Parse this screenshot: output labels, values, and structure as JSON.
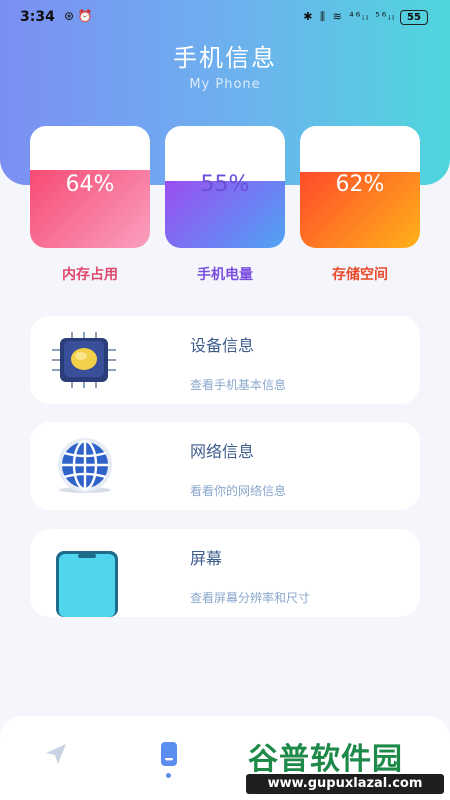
{
  "status_bar": {
    "time": "3:34",
    "left_icons": "⊛ ⏰",
    "right_icons": "✱ ⫼ ≋ ⁴⁶ᵢₗ ⁵⁶ᵢₗ",
    "battery": "55"
  },
  "header": {
    "title": "手机信息",
    "subtitle": "My Phone"
  },
  "stats": [
    {
      "value": "64%",
      "label": "内存占用",
      "fraction": 0.64,
      "gradient": [
        "#f84a73",
        "#f9a0c0"
      ],
      "label_color": "#e3476c"
    },
    {
      "value": "55%",
      "label": "手机电量",
      "fraction": 0.55,
      "gradient": [
        "#9a4ef0",
        "#4fa3f5"
      ],
      "label_color": "#7a4fe0"
    },
    {
      "value": "62%",
      "label": "存储空间",
      "fraction": 0.62,
      "gradient": [
        "#ff4a2a",
        "#ffb21a"
      ],
      "label_color": "#ea4a2c"
    }
  ],
  "info_items": [
    {
      "title": "设备信息",
      "desc": "查看手机基本信息",
      "icon": "chip-icon"
    },
    {
      "title": "网络信息",
      "desc": "看看你的网络信息",
      "icon": "globe-icon"
    },
    {
      "title": "屏幕",
      "desc": "查看屏幕分辨率和尺寸",
      "icon": "phone-screen-icon"
    }
  ],
  "nav": {
    "items": [
      "send-icon",
      "phone-icon"
    ],
    "active": 1
  },
  "watermark": {
    "main": "谷普软件园",
    "url": "www.gupuxlazal.com"
  },
  "colors": {
    "accent": "#5b8ef0",
    "card_title": "#3e5e8c",
    "card_desc": "#8aa7cc"
  }
}
